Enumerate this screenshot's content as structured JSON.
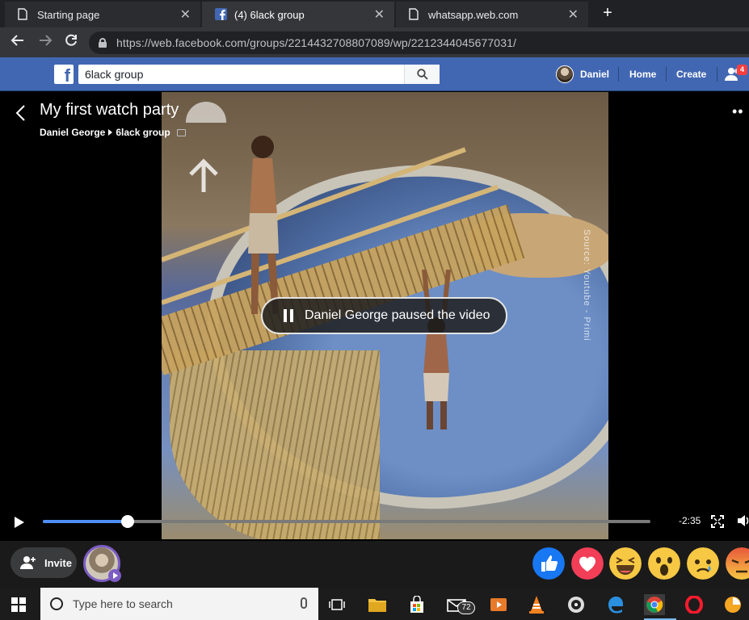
{
  "browser": {
    "tabs": [
      {
        "title": "Starting page"
      },
      {
        "title": "(4) 6lack group"
      },
      {
        "title": "whatsapp.web.com"
      }
    ],
    "url": "https://web.facebook.com/groups/2214432708807089/wp/2212344045677031/"
  },
  "facebook": {
    "search_value": "6lack group",
    "nav": {
      "user_name": "Daniel",
      "home": "Home",
      "create": "Create",
      "friend_requests_count": "4"
    }
  },
  "watch_party": {
    "title": "My first watch party",
    "host": "Daniel George",
    "group": "6lack group",
    "status_message": "Daniel George paused the video",
    "video_watermark": "Source: Youtube - Primi",
    "time_remaining": "-2:35",
    "progress": 0.14
  },
  "bottom": {
    "invite_label": "Invite",
    "reactions": [
      "like",
      "love",
      "haha",
      "wow",
      "sad",
      "angry"
    ]
  },
  "taskbar": {
    "search_placeholder": "Type here to search",
    "mail_badge": "72"
  },
  "colors": {
    "facebook_blue": "#4267b2",
    "progress_blue": "#4e8ef7",
    "viewer_ring": "#7c5cc4"
  }
}
